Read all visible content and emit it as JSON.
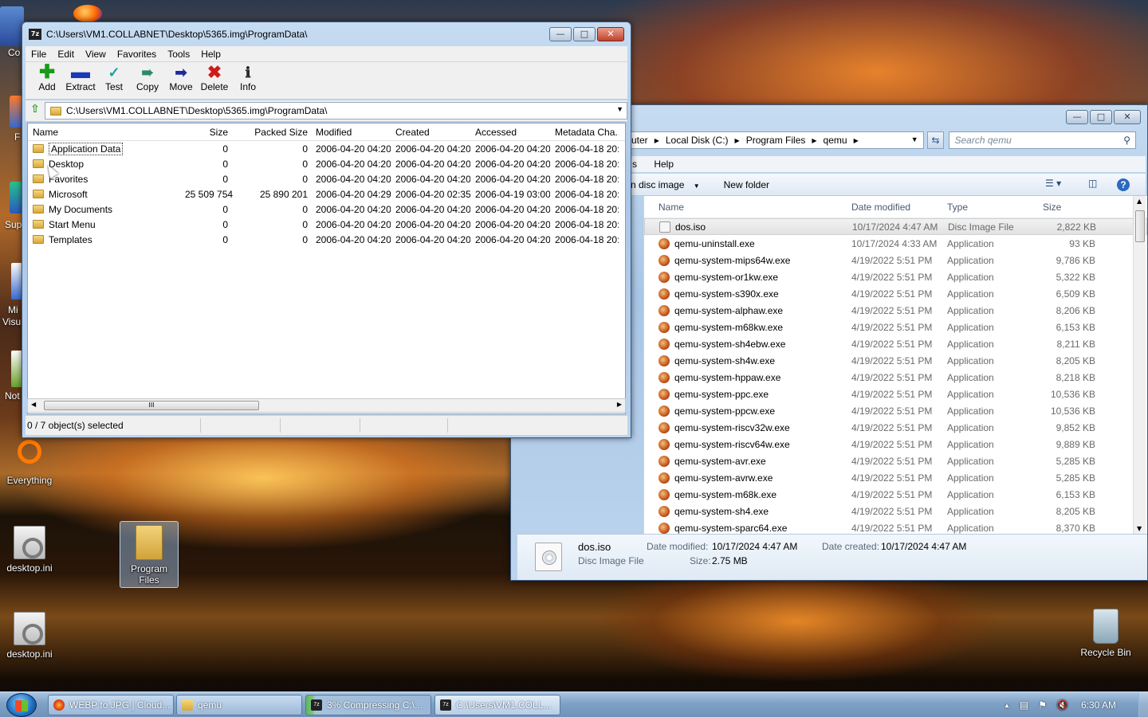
{
  "desktop": {
    "icons": [
      {
        "label": "Everything"
      },
      {
        "label": "desktop.ini"
      },
      {
        "label": "Program Files"
      },
      {
        "label": "desktop.ini"
      },
      {
        "label": "Recycle Bin"
      }
    ],
    "partial_labels": [
      "Co",
      "F",
      "Sup",
      "Mi",
      "Visu",
      "Not"
    ]
  },
  "zip_window": {
    "title": "C:\\Users\\VM1.COLLABNET\\Desktop\\5365.img\\ProgramData\\",
    "menu": [
      "File",
      "Edit",
      "View",
      "Favorites",
      "Tools",
      "Help"
    ],
    "toolbar": [
      {
        "label": "Add",
        "icon": "plus-icon",
        "color": "#1a9a1a"
      },
      {
        "label": "Extract",
        "icon": "minus-icon",
        "color": "#1a3ab8"
      },
      {
        "label": "Test",
        "icon": "check-icon",
        "color": "#1aa0a0"
      },
      {
        "label": "Copy",
        "icon": "copy-arrow-icon",
        "color": "#2a8a6a"
      },
      {
        "label": "Move",
        "icon": "move-arrow-icon",
        "color": "#1a2a9a"
      },
      {
        "label": "Delete",
        "icon": "delete-x-icon",
        "color": "#d01a1a"
      },
      {
        "label": "Info",
        "icon": "info-icon",
        "color": "#2a2a2a"
      }
    ],
    "address": "C:\\Users\\VM1.COLLABNET\\Desktop\\5365.img\\ProgramData\\",
    "columns": [
      "Name",
      "Size",
      "Packed Size",
      "Modified",
      "Created",
      "Accessed",
      "Metadata Cha..."
    ],
    "rows": [
      {
        "name": "Application Data",
        "size": "0",
        "packed": "0",
        "modified": "2006-04-20 04:20",
        "created": "2006-04-20 04:20",
        "accessed": "2006-04-20 04:20",
        "meta": "2006-04-18 20:3"
      },
      {
        "name": "Desktop",
        "size": "0",
        "packed": "0",
        "modified": "2006-04-20 04:20",
        "created": "2006-04-20 04:20",
        "accessed": "2006-04-20 04:20",
        "meta": "2006-04-18 20:3"
      },
      {
        "name": "Favorites",
        "size": "0",
        "packed": "0",
        "modified": "2006-04-20 04:20",
        "created": "2006-04-20 04:20",
        "accessed": "2006-04-20 04:20",
        "meta": "2006-04-18 20:3"
      },
      {
        "name": "Microsoft",
        "size": "25 509 754",
        "packed": "25 890 201",
        "modified": "2006-04-20 04:29",
        "created": "2006-04-20 02:35",
        "accessed": "2006-04-19 03:00",
        "meta": "2006-04-18 20:3"
      },
      {
        "name": "My Documents",
        "size": "0",
        "packed": "0",
        "modified": "2006-04-20 04:20",
        "created": "2006-04-20 04:20",
        "accessed": "2006-04-20 04:20",
        "meta": "2006-04-18 20:3"
      },
      {
        "name": "Start Menu",
        "size": "0",
        "packed": "0",
        "modified": "2006-04-20 04:20",
        "created": "2006-04-20 04:20",
        "accessed": "2006-04-20 04:20",
        "meta": "2006-04-18 20:3"
      },
      {
        "name": "Templates",
        "size": "0",
        "packed": "0",
        "modified": "2006-04-20 04:20",
        "created": "2006-04-20 04:20",
        "accessed": "2006-04-20 04:20",
        "meta": "2006-04-18 20:3"
      }
    ],
    "status": "0 / 7 object(s) selected"
  },
  "explorer_window": {
    "breadcrumb": [
      "uter",
      "Local Disk (C:)",
      "Program Files",
      "qemu"
    ],
    "search_placeholder": "Search qemu",
    "menu": [
      "s",
      "Help"
    ],
    "commands": {
      "burn": "n disc image",
      "new_folder": "New folder"
    },
    "columns": [
      "Name",
      "Date modified",
      "Type",
      "Size"
    ],
    "files": [
      {
        "name": "dos.iso",
        "date": "10/17/2024 4:47 AM",
        "type": "Disc Image File",
        "size": "2,822 KB",
        "icon": "disc-image-icon"
      },
      {
        "name": "qemu-uninstall.exe",
        "date": "10/17/2024 4:33 AM",
        "type": "Application",
        "size": "93 KB",
        "icon": "qemu-icon"
      },
      {
        "name": "qemu-system-mips64w.exe",
        "date": "4/19/2022 5:51 PM",
        "type": "Application",
        "size": "9,786 KB",
        "icon": "qemu-icon"
      },
      {
        "name": "qemu-system-or1kw.exe",
        "date": "4/19/2022 5:51 PM",
        "type": "Application",
        "size": "5,322 KB",
        "icon": "qemu-icon"
      },
      {
        "name": "qemu-system-s390x.exe",
        "date": "4/19/2022 5:51 PM",
        "type": "Application",
        "size": "6,509 KB",
        "icon": "qemu-icon"
      },
      {
        "name": "qemu-system-alphaw.exe",
        "date": "4/19/2022 5:51 PM",
        "type": "Application",
        "size": "8,206 KB",
        "icon": "qemu-icon"
      },
      {
        "name": "qemu-system-m68kw.exe",
        "date": "4/19/2022 5:51 PM",
        "type": "Application",
        "size": "6,153 KB",
        "icon": "qemu-icon"
      },
      {
        "name": "qemu-system-sh4ebw.exe",
        "date": "4/19/2022 5:51 PM",
        "type": "Application",
        "size": "8,211 KB",
        "icon": "qemu-icon"
      },
      {
        "name": "qemu-system-sh4w.exe",
        "date": "4/19/2022 5:51 PM",
        "type": "Application",
        "size": "8,205 KB",
        "icon": "qemu-icon"
      },
      {
        "name": "qemu-system-hppaw.exe",
        "date": "4/19/2022 5:51 PM",
        "type": "Application",
        "size": "8,218 KB",
        "icon": "qemu-icon"
      },
      {
        "name": "qemu-system-ppc.exe",
        "date": "4/19/2022 5:51 PM",
        "type": "Application",
        "size": "10,536 KB",
        "icon": "qemu-icon"
      },
      {
        "name": "qemu-system-ppcw.exe",
        "date": "4/19/2022 5:51 PM",
        "type": "Application",
        "size": "10,536 KB",
        "icon": "qemu-icon"
      },
      {
        "name": "qemu-system-riscv32w.exe",
        "date": "4/19/2022 5:51 PM",
        "type": "Application",
        "size": "9,852 KB",
        "icon": "qemu-icon"
      },
      {
        "name": "qemu-system-riscv64w.exe",
        "date": "4/19/2022 5:51 PM",
        "type": "Application",
        "size": "9,889 KB",
        "icon": "qemu-icon"
      },
      {
        "name": "qemu-system-avr.exe",
        "date": "4/19/2022 5:51 PM",
        "type": "Application",
        "size": "5,285 KB",
        "icon": "qemu-icon"
      },
      {
        "name": "qemu-system-avrw.exe",
        "date": "4/19/2022 5:51 PM",
        "type": "Application",
        "size": "5,285 KB",
        "icon": "qemu-icon"
      },
      {
        "name": "qemu-system-m68k.exe",
        "date": "4/19/2022 5:51 PM",
        "type": "Application",
        "size": "6,153 KB",
        "icon": "qemu-icon"
      },
      {
        "name": "qemu-system-sh4.exe",
        "date": "4/19/2022 5:51 PM",
        "type": "Application",
        "size": "8,205 KB",
        "icon": "qemu-icon"
      },
      {
        "name": "qemu-system-sparc64.exe",
        "date": "4/19/2022 5:51 PM",
        "type": "Application",
        "size": "8,370 KB",
        "icon": "qemu-icon"
      }
    ],
    "details": {
      "name": "dos.iso",
      "type": "Disc Image File",
      "modified_label": "Date modified:",
      "modified": "10/17/2024 4:47 AM",
      "created_label": "Date created:",
      "created": "10/17/2024 4:47 AM",
      "size_label": "Size:",
      "size": "2.75 MB"
    }
  },
  "taskbar": {
    "buttons": [
      {
        "label": "WEBP to JPG | Cloud...",
        "icon": "firefox-icon"
      },
      {
        "label": "qemu",
        "icon": "folder-icon"
      },
      {
        "label": "3% Compressing C:\\...",
        "icon": "7zip-icon"
      },
      {
        "label": "C:\\Users\\VM1.COLL...",
        "icon": "7zip-icon"
      }
    ],
    "clock": "6:30 AM"
  }
}
